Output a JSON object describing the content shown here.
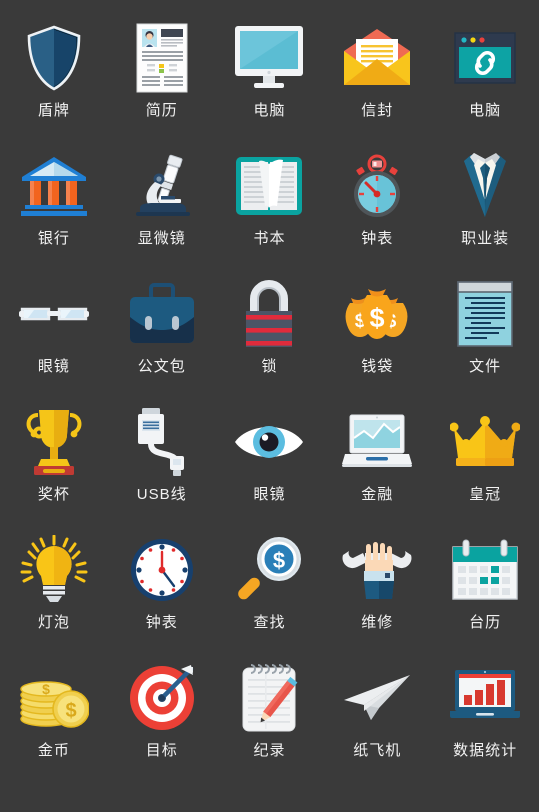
{
  "page": {
    "background_color": "#3a3a3a",
    "label_color": "#f2f2f2",
    "columns": 5,
    "rows": 6
  },
  "palette": {
    "navy": "#1b4566",
    "navy_dark": "#12314a",
    "navy_darkest": "#1f2f44",
    "teal": "#0aa3a0",
    "teal_light": "#6fcbdc",
    "sky": "#79cde0",
    "sky_light": "#a9dfe8",
    "orange": "#f2641e",
    "orange_light": "#f58a5a",
    "blue": "#1f7fd4",
    "red": "#e8413c",
    "red_dark": "#c9302c",
    "yellow": "#f9c517",
    "gold": "#f5a623",
    "white": "#ffffff",
    "offwhite": "#f3f4f5",
    "grey": "#d5d9dd",
    "grey_dark": "#9aa3ab"
  },
  "icons": [
    {
      "id": "shield",
      "label": "盾牌",
      "name": "shield-icon"
    },
    {
      "id": "resume",
      "label": "简历",
      "name": "resume-icon"
    },
    {
      "id": "monitor",
      "label": "电脑",
      "name": "monitor-icon"
    },
    {
      "id": "envelope",
      "label": "信封",
      "name": "envelope-icon"
    },
    {
      "id": "browser",
      "label": "电脑",
      "name": "browser-link-icon"
    },
    {
      "id": "bank",
      "label": "银行",
      "name": "bank-icon"
    },
    {
      "id": "microscope",
      "label": "显微镜",
      "name": "microscope-icon"
    },
    {
      "id": "book",
      "label": "书本",
      "name": "book-icon"
    },
    {
      "id": "stopwatch",
      "label": "钟表",
      "name": "stopwatch-icon"
    },
    {
      "id": "suit",
      "label": "职业装",
      "name": "business-suit-icon"
    },
    {
      "id": "glasses",
      "label": "眼镜",
      "name": "glasses-icon"
    },
    {
      "id": "briefcase",
      "label": "公文包",
      "name": "briefcase-icon"
    },
    {
      "id": "lock",
      "label": "锁",
      "name": "lock-icon"
    },
    {
      "id": "moneybags",
      "label": "钱袋",
      "name": "money-bags-icon"
    },
    {
      "id": "document",
      "label": "文件",
      "name": "document-icon"
    },
    {
      "id": "trophy",
      "label": "奖杯",
      "name": "trophy-icon"
    },
    {
      "id": "usb",
      "label": "USB线",
      "name": "usb-cable-icon"
    },
    {
      "id": "eye",
      "label": "眼镜",
      "name": "eye-icon"
    },
    {
      "id": "laptopchart",
      "label": "金融",
      "name": "finance-laptop-icon"
    },
    {
      "id": "crown",
      "label": "皇冠",
      "name": "crown-icon"
    },
    {
      "id": "bulb",
      "label": "灯泡",
      "name": "lightbulb-icon"
    },
    {
      "id": "clock",
      "label": "钟表",
      "name": "clock-icon"
    },
    {
      "id": "search",
      "label": "查找",
      "name": "search-dollar-icon"
    },
    {
      "id": "wrench",
      "label": "维修",
      "name": "wrench-hand-icon"
    },
    {
      "id": "calendar",
      "label": "台历",
      "name": "calendar-icon"
    },
    {
      "id": "coins",
      "label": "金币",
      "name": "gold-coins-icon"
    },
    {
      "id": "target",
      "label": "目标",
      "name": "target-arrow-icon"
    },
    {
      "id": "notepad",
      "label": "纪录",
      "name": "notepad-pencil-icon"
    },
    {
      "id": "plane",
      "label": "纸飞机",
      "name": "paper-plane-icon"
    },
    {
      "id": "statchart",
      "label": "数据统计",
      "name": "data-statistics-icon"
    }
  ]
}
